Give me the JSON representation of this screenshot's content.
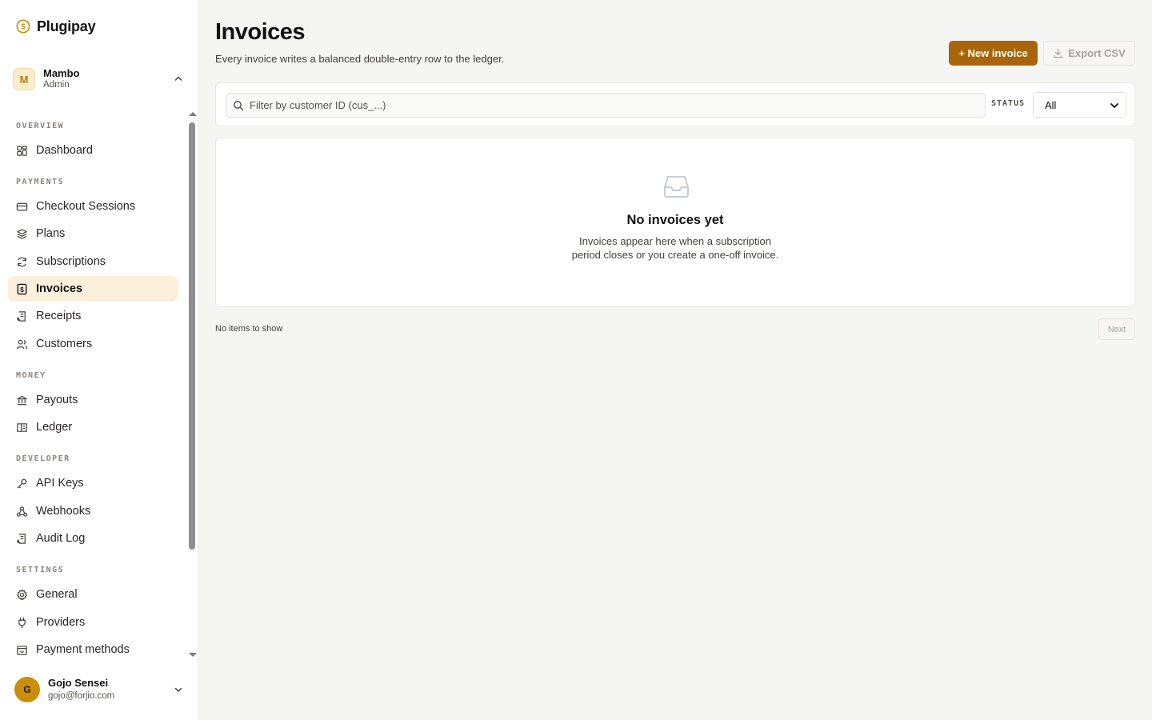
{
  "brand": {
    "name": "Plugipay",
    "icon": "dollar-circle-icon"
  },
  "org": {
    "initial": "M",
    "name": "Mambo",
    "role": "Admin"
  },
  "nav": {
    "sections": [
      {
        "title": "OVERVIEW",
        "items": [
          {
            "label": "Dashboard",
            "icon": "grid-icon"
          }
        ]
      },
      {
        "title": "PAYMENTS",
        "items": [
          {
            "label": "Checkout Sessions",
            "icon": "card-icon"
          },
          {
            "label": "Plans",
            "icon": "layers-icon"
          },
          {
            "label": "Subscriptions",
            "icon": "refresh-icon"
          },
          {
            "label": "Invoices",
            "icon": "invoice-icon",
            "active": true
          },
          {
            "label": "Receipts",
            "icon": "receipt-icon"
          },
          {
            "label": "Customers",
            "icon": "users-icon"
          }
        ]
      },
      {
        "title": "MONEY",
        "items": [
          {
            "label": "Payouts",
            "icon": "bank-icon"
          },
          {
            "label": "Ledger",
            "icon": "book-icon"
          }
        ]
      },
      {
        "title": "DEVELOPER",
        "items": [
          {
            "label": "API Keys",
            "icon": "key-icon"
          },
          {
            "label": "Webhooks",
            "icon": "webhook-icon"
          },
          {
            "label": "Audit Log",
            "icon": "scroll-icon"
          }
        ]
      },
      {
        "title": "SETTINGS",
        "items": [
          {
            "label": "General",
            "icon": "gear-icon"
          },
          {
            "label": "Providers",
            "icon": "plug-icon"
          },
          {
            "label": "Payment methods",
            "icon": "wallet-icon"
          }
        ]
      }
    ]
  },
  "user": {
    "initial": "G",
    "name": "Gojo Sensei",
    "email": "gojo@forjio.com"
  },
  "page": {
    "title": "Invoices",
    "subtitle": "Every invoice writes a balanced double-entry row to the ledger.",
    "new_button": "+ New invoice",
    "export_button": "Export CSV"
  },
  "filter": {
    "search_placeholder": "Filter by customer ID (cus_...)",
    "status_label": "STATUS",
    "status_value": "All"
  },
  "empty": {
    "title": "No invoices yet",
    "line1": "Invoices appear here when a subscription",
    "line2": "period closes or you create a one-off invoice."
  },
  "pager": {
    "info": "No items to show",
    "next": "Next"
  },
  "colors": {
    "accent": "#a8650a",
    "active_nav_bg": "#fbf0dc",
    "background": "#f5f5f3"
  }
}
